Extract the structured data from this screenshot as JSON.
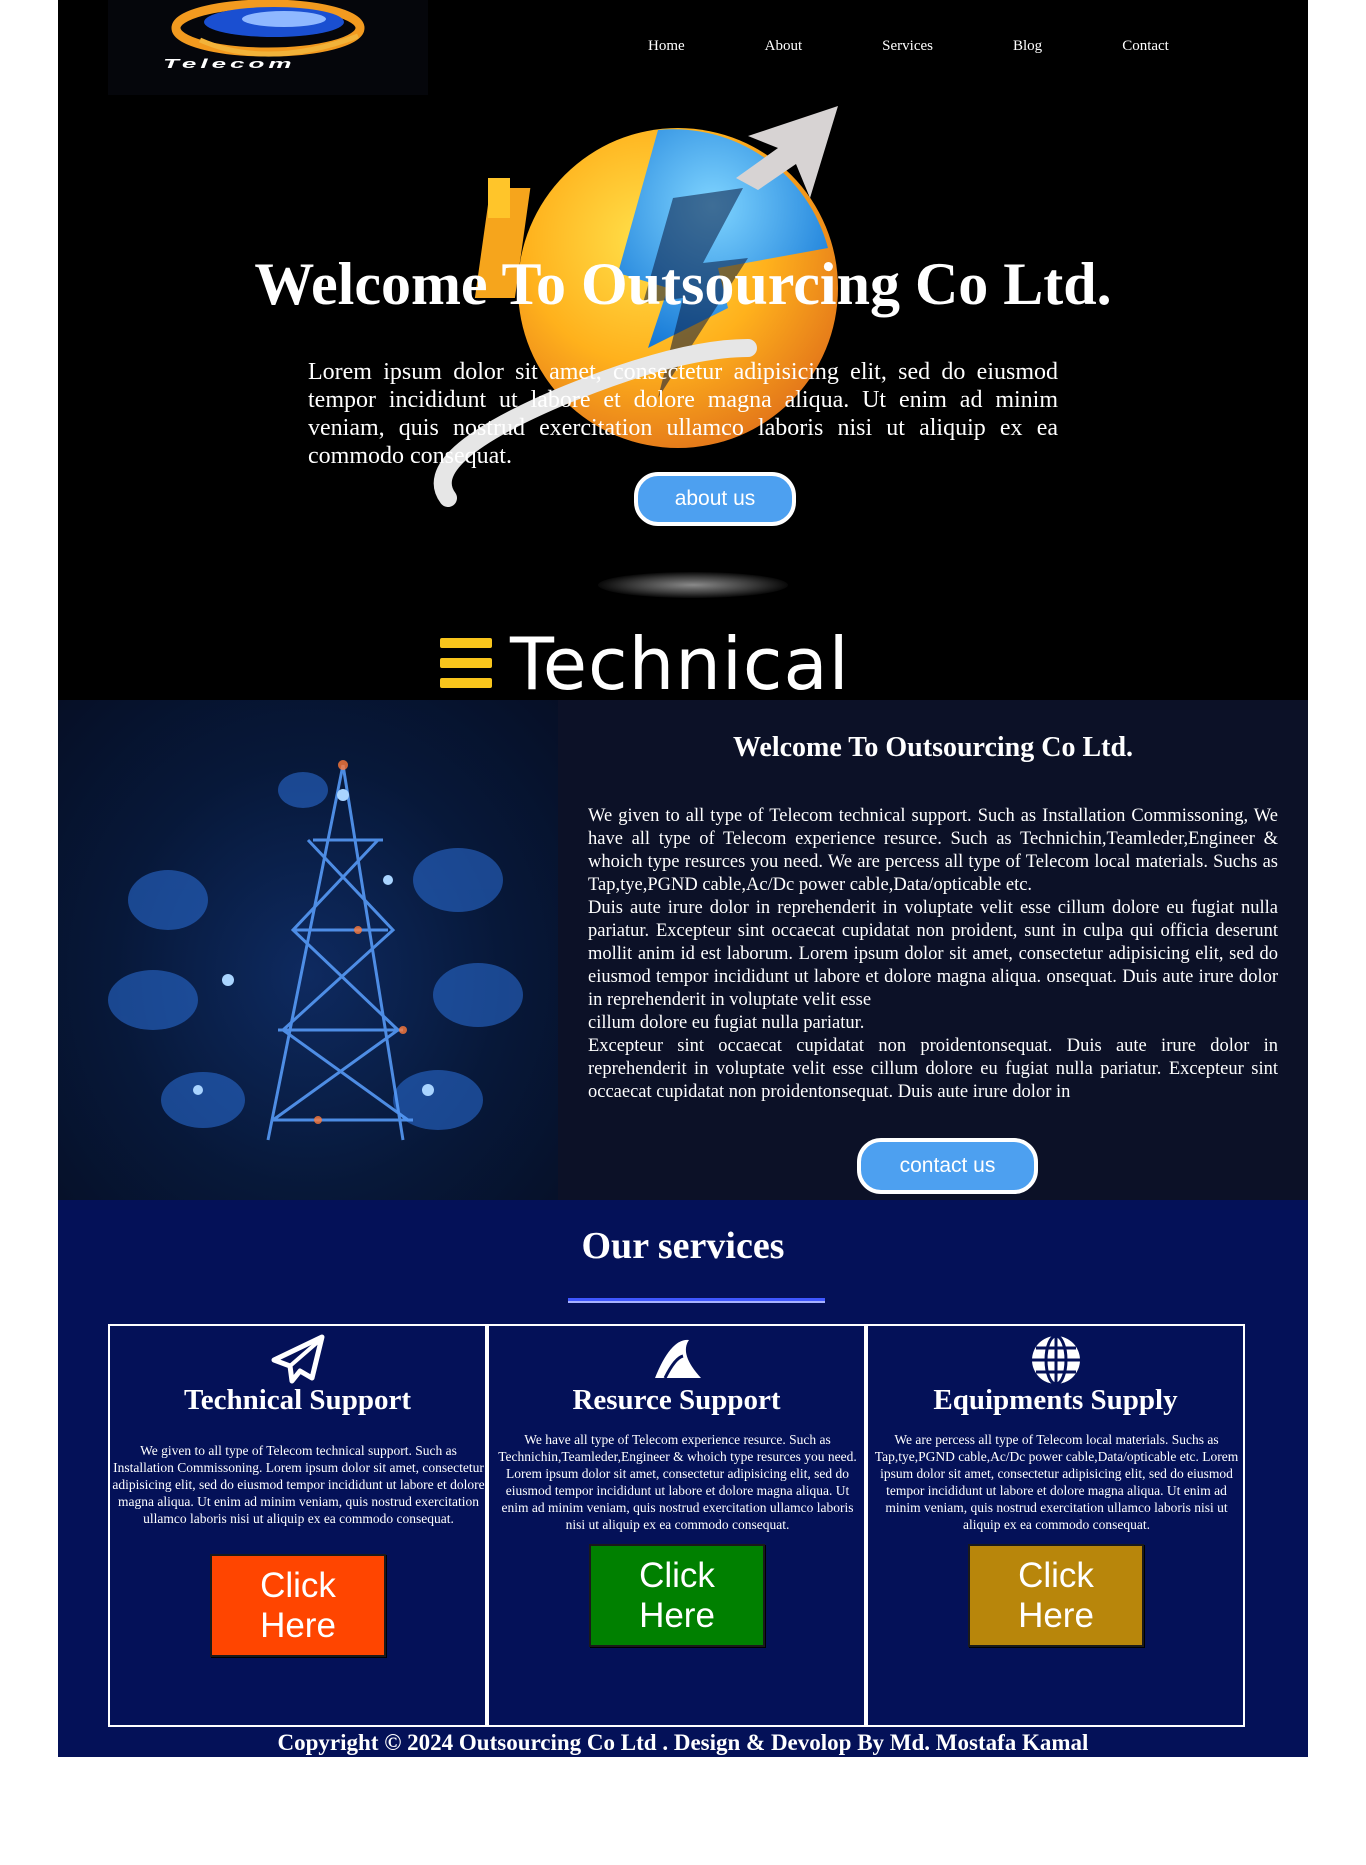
{
  "brand": {
    "logo_text": "Telecom"
  },
  "nav": {
    "items": [
      "Home",
      "About",
      "Services",
      "Blog",
      "Contact"
    ]
  },
  "hero": {
    "title": "Welcome To Outsourcing Co Ltd.",
    "text": "Lorem ipsum dolor sit amet, consectetur adipisicing elit, sed do eiusmod tempor incididunt ut labore et dolore magna aliqua. Ut enim ad minim veniam, quis nostrud exercitation ullamco laboris nisi ut aliquip ex ea commodo consequat.",
    "button": "about us",
    "banner_word": "Technical"
  },
  "about": {
    "title": "Welcome To Outsourcing Co Ltd.",
    "paragraphs": [
      "We given to all type of Telecom technical support. Such as Installation Commissoning, We have all type of Telecom experience resurce. Such as Technichin,Teamleder,Engineer & whoich type resurces you need. We are percess all type of Telecom local materials. Suchs as Tap,tye,PGND cable,Ac/Dc power cable,Data/opticable etc.",
      "Duis aute irure dolor in reprehenderit in voluptate velit esse cillum dolore eu fugiat nulla pariatur. Excepteur sint occaecat cupidatat non proident, sunt in culpa qui officia deserunt mollit anim id est laborum. Lorem ipsum dolor sit amet, consectetur adipisicing elit, sed do eiusmod tempor incididunt ut labore et dolore magna aliqua. onsequat. Duis aute irure dolor in reprehenderit in voluptate velit esse",
      "cillum dolore eu fugiat nulla pariatur.",
      "Excepteur sint occaecat cupidatat non proidentonsequat. Duis aute irure dolor in reprehenderit in voluptate velit esse cillum dolore eu fugiat nulla pariatur. Excepteur sint occaecat cupidatat non proidentonsequat. Duis aute irure dolor in"
    ],
    "button": "contact us"
  },
  "services": {
    "title": "Our services",
    "cards": [
      {
        "icon": "paper-plane-icon",
        "title": "Technical Support",
        "text": "We given to all type of Telecom technical support. Such as Installation Commissoning. Lorem ipsum dolor sit amet, consectetur adipisicing elit, sed do eiusmod tempor incididunt ut labore et dolore magna aliqua. Ut enim ad minim veniam, quis nostrud exercitation ullamco laboris nisi ut aliquip ex ea commodo consequat.",
        "button": "Click Here",
        "button_color": "#ff4500"
      },
      {
        "icon": "shark-fin-icon",
        "title": "Resurce Support",
        "text": "We have all type of Telecom experience resurce. Such as Technichin,Teamleder,Engineer & whoich type resurces you need. Lorem ipsum dolor sit amet, consectetur adipisicing elit, sed do eiusmod tempor incididunt ut labore et dolore magna aliqua. Ut enim ad minim veniam, quis nostrud exercitation ullamco laboris nisi ut aliquip ex ea commodo consequat.",
        "button": "Click Here",
        "button_color": "#008000"
      },
      {
        "icon": "globe-icon",
        "title": "Equipments Supply",
        "text": "We are percess all type of Telecom local materials. Suchs as Tap,tye,PGND cable,Ac/Dc power cable,Data/opticable etc. Lorem ipsum dolor sit amet, consectetur adipisicing elit, sed do eiusmod tempor incididunt ut labore et dolore magna aliqua. Ut enim ad minim veniam, quis nostrud exercitation ullamco laboris nisi ut aliquip ex ea commodo consequat.",
        "button": "Click Here",
        "button_color": "#b8860b"
      }
    ]
  },
  "footer": {
    "text": "Copyright © 2024 Outsourcing Co Ltd . Design & Devolop By Md. Mostafa Kamal"
  },
  "colors": {
    "hero_bg": "#000000",
    "about_bg": "#0c1127",
    "services_bg": "#041158",
    "pill_button": "#4da0f0"
  }
}
